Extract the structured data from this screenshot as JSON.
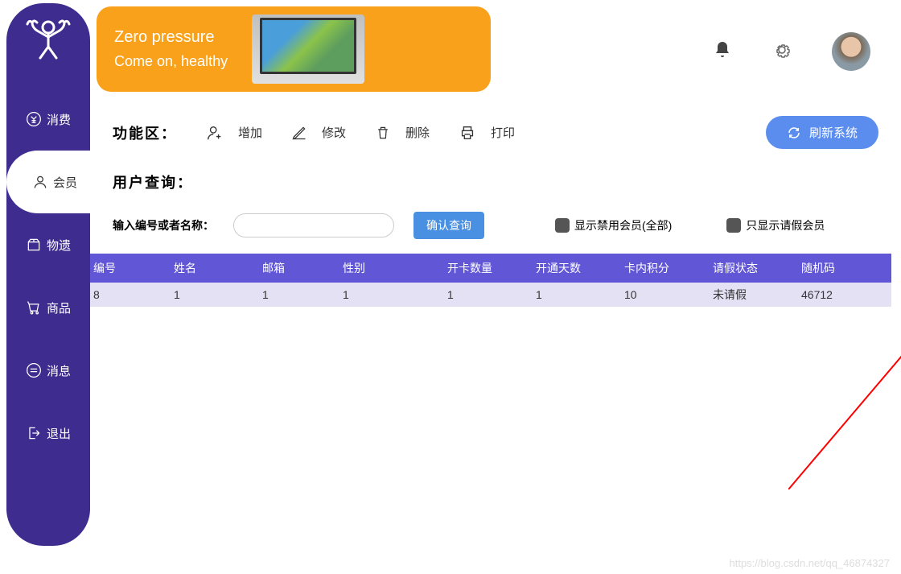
{
  "banner": {
    "line1": "Zero pressure",
    "line2": "Come on, healthy"
  },
  "sidebar": {
    "items": [
      {
        "label": "消费",
        "icon": "yen"
      },
      {
        "label": "会员",
        "icon": "user",
        "active": true
      },
      {
        "label": "物遗",
        "icon": "box"
      },
      {
        "label": "商品",
        "icon": "cart"
      },
      {
        "label": "消息",
        "icon": "msg"
      },
      {
        "label": "退出",
        "icon": "exit"
      }
    ]
  },
  "toolbar": {
    "title": "功能区：",
    "add": "增加",
    "edit": "修改",
    "delete": "删除",
    "print": "打印",
    "refresh": "刷新系统"
  },
  "search": {
    "title": "用户查询：",
    "input_label": "输入编号或者名称：",
    "confirm": "确认查询",
    "cb1": "显示禁用会员(全部)",
    "cb2": "只显示请假会员"
  },
  "table": {
    "headers": [
      "编号",
      "姓名",
      "邮箱",
      "性别",
      "开卡数量",
      "开通天数",
      "卡内积分",
      "请假状态",
      "随机码"
    ],
    "rows": [
      {
        "cells": [
          "8",
          "1",
          "1",
          "1",
          "1",
          "1",
          "10",
          "未请假",
          "46712"
        ]
      }
    ]
  },
  "watermark": "https://blog.csdn.net/qq_46874327"
}
